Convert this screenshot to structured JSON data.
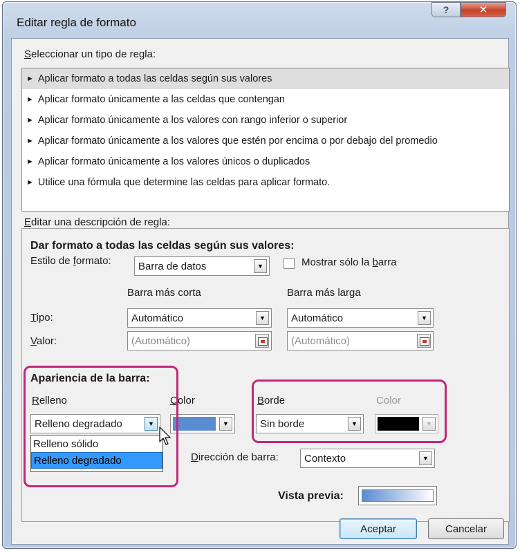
{
  "window": {
    "title": "Editar regla de formato",
    "help_glyph": "?",
    "close_glyph": "✕"
  },
  "rule_type": {
    "label_prefix": "",
    "label_underline": "S",
    "label_rest": "eleccionar un tipo de regla:",
    "items": [
      "Aplicar formato a todas las celdas según sus valores",
      "Aplicar formato únicamente a las celdas que contengan",
      "Aplicar formato únicamente a los valores con rango inferior o superior",
      "Aplicar formato únicamente a los valores que estén por encima o por debajo del promedio",
      "Aplicar formato únicamente a los valores únicos o duplicados",
      "Utilice una fórmula que determine las celdas para aplicar formato."
    ],
    "selected_index": 0
  },
  "description": {
    "label_underline": "E",
    "label_rest": "ditar una descripción de regla:",
    "heading": "Dar formato a todas las celdas según sus valores:",
    "format_style_pre": "Estilo de ",
    "format_style_ul": "f",
    "format_style_post": "ormato:",
    "format_style_value": "Barra de datos",
    "show_bar_only_pre": "Mostrar sólo la ",
    "show_bar_only_ul": "b",
    "show_bar_only_post": "arra",
    "show_bar_only_checked": false,
    "shortest_bar": "Barra más corta",
    "longest_bar": "Barra más larga",
    "type_ul": "T",
    "type_rest": "ipo:",
    "value_ul": "V",
    "value_rest": "alor:",
    "type_short_value": "Automático",
    "type_long_value": "Automático",
    "value_short": "(Automático)",
    "value_long": "(Automático)"
  },
  "appearance": {
    "heading": "Apariencia de la barra:",
    "fill_ul": "R",
    "fill_rest": "elleno",
    "fill_value": "Relleno degradado",
    "fill_options": [
      "Relleno sólido",
      "Relleno degradado"
    ],
    "fill_selected_index": 1,
    "color_ul": "C",
    "color_rest": "olor",
    "fill_color": "#5b8bd0",
    "border_ul": "B",
    "border_rest": "orde",
    "border_value": "Sin borde",
    "border_color_label": "Color",
    "border_color": "#000000",
    "direction_ul": "D",
    "direction_rest": "irección de barra:",
    "direction_value": "Contexto",
    "preview_label": "Vista previa:"
  },
  "buttons": {
    "ok": "Aceptar",
    "cancel": "Cancelar"
  },
  "colors": {
    "highlight": "#c0277a",
    "selection": "#3399ff"
  }
}
